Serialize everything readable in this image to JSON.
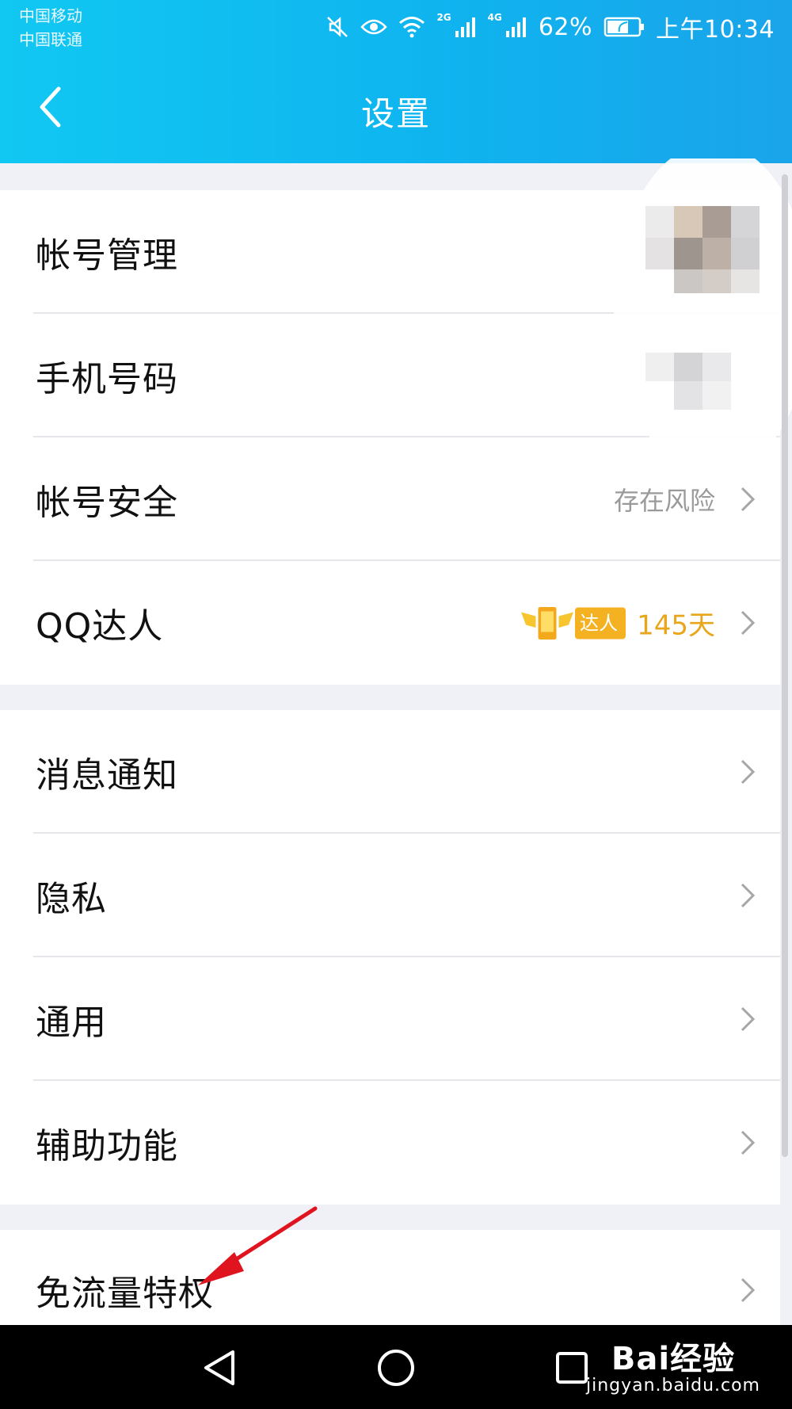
{
  "status_bar": {
    "carrier_1": "中国移动",
    "carrier_2": "中国联通",
    "net_2g": "2G",
    "net_4g": "4G",
    "battery": "62%",
    "time": "上午10:34"
  },
  "header": {
    "title": "设置"
  },
  "groups": [
    {
      "items": [
        {
          "label": "帐号管理"
        },
        {
          "label": "手机号码"
        },
        {
          "label": "帐号安全",
          "value": "存在风险"
        },
        {
          "label": "QQ达人",
          "badge": "达人",
          "days": "145天"
        }
      ]
    },
    {
      "items": [
        {
          "label": "消息通知"
        },
        {
          "label": "隐私"
        },
        {
          "label": "通用"
        },
        {
          "label": "辅助功能"
        }
      ]
    },
    {
      "items": [
        {
          "label": "免流量特权"
        }
      ]
    }
  ],
  "watermark": {
    "brand": "Bai经验",
    "url": "jingyan.baidu.com"
  },
  "colors": {
    "header_gradient_start": "#11c8f2",
    "header_gradient_end": "#1aa4ea",
    "badge": "#f4b223",
    "arrow": "#e0141e"
  }
}
